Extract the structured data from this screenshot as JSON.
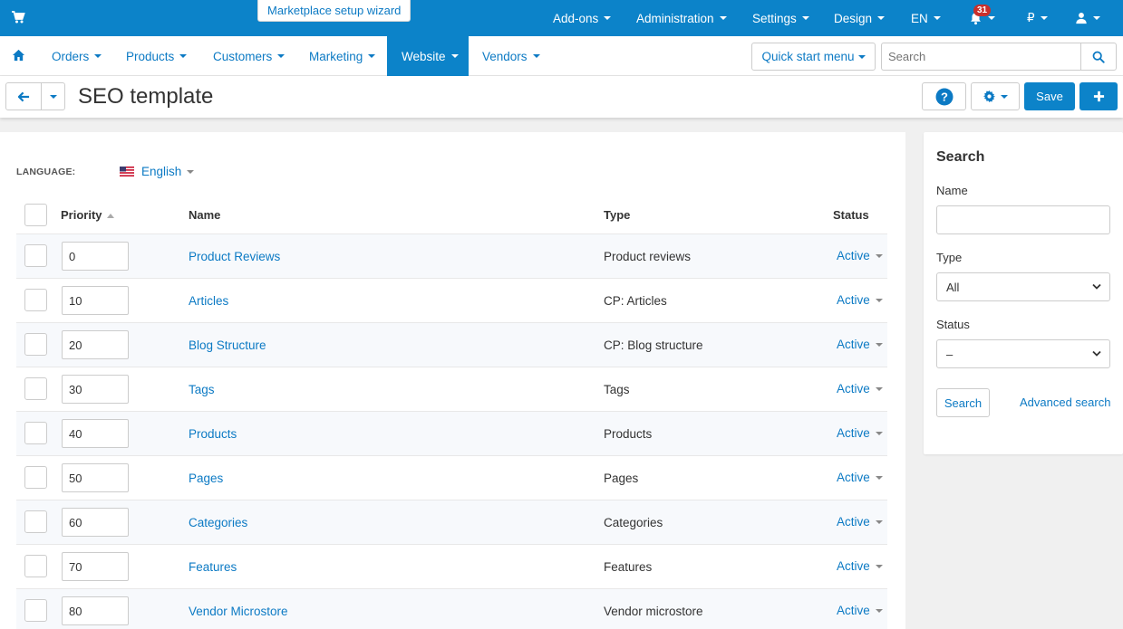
{
  "topbar": {
    "wizard_label": "Marketplace setup wizard",
    "menus": {
      "addons": "Add-ons",
      "administration": "Administration",
      "settings": "Settings",
      "design": "Design",
      "language": "EN",
      "currency": "₽"
    },
    "notifications_count": "31",
    "brand_color": "#0c83c9"
  },
  "mainnav": {
    "orders": "Orders",
    "products": "Products",
    "customers": "Customers",
    "marketing": "Marketing",
    "website": "Website",
    "vendors": "Vendors",
    "active": "Website",
    "quick_start": "Quick start menu",
    "search_placeholder": "Search"
  },
  "titlebar": {
    "title": "SEO template",
    "save_label": "Save"
  },
  "language": {
    "label": "LANGUAGE:",
    "value": "English"
  },
  "table": {
    "headers": {
      "priority": "Priority",
      "name": "Name",
      "type": "Type",
      "status": "Status"
    },
    "rows": [
      {
        "priority": "0",
        "name": "Product Reviews",
        "type": "Product reviews",
        "status": "Active"
      },
      {
        "priority": "10",
        "name": "Articles",
        "type": "CP: Articles",
        "status": "Active"
      },
      {
        "priority": "20",
        "name": "Blog Structure",
        "type": "CP: Blog structure",
        "status": "Active"
      },
      {
        "priority": "30",
        "name": "Tags",
        "type": "Tags",
        "status": "Active"
      },
      {
        "priority": "40",
        "name": "Products",
        "type": "Products",
        "status": "Active"
      },
      {
        "priority": "50",
        "name": "Pages",
        "type": "Pages",
        "status": "Active"
      },
      {
        "priority": "60",
        "name": "Categories",
        "type": "Categories",
        "status": "Active"
      },
      {
        "priority": "70",
        "name": "Features",
        "type": "Features",
        "status": "Active"
      },
      {
        "priority": "80",
        "name": "Vendor Microstore",
        "type": "Vendor microstore",
        "status": "Active"
      }
    ]
  },
  "sidebar": {
    "title": "Search",
    "name_label": "Name",
    "name_value": "",
    "type_label": "Type",
    "type_value": "All",
    "status_label": "Status",
    "status_value": "–",
    "search_button": "Search",
    "advanced_search": "Advanced search"
  }
}
